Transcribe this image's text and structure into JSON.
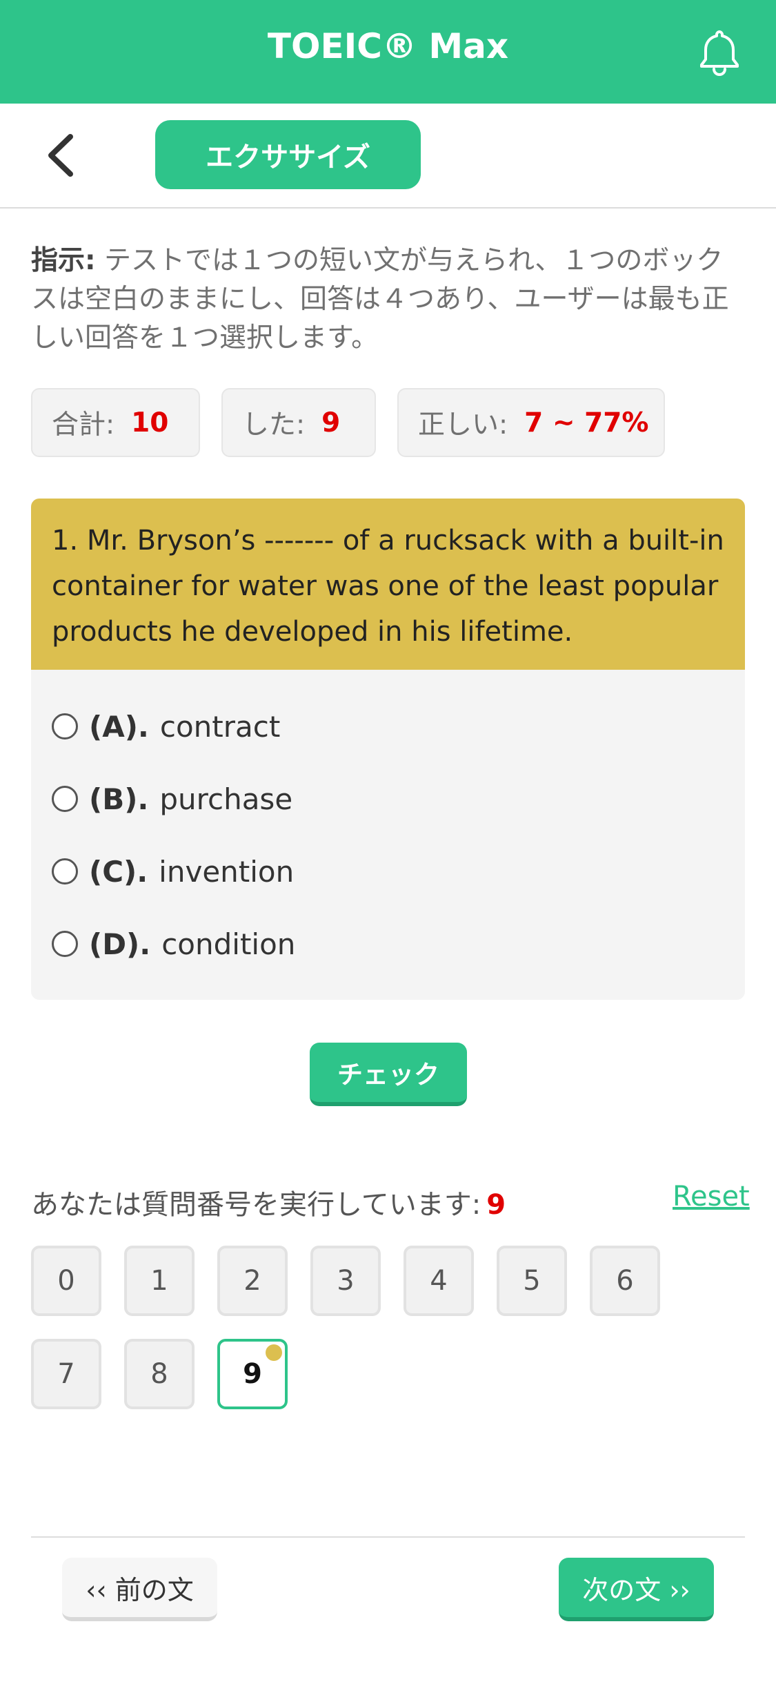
{
  "header": {
    "title": "TOEIC® Max",
    "bell_icon": "bell-icon",
    "accent_color": "#2ec48a"
  },
  "subbar": {
    "back_icon": "chevron-left-icon",
    "tab_label": "エクササイズ"
  },
  "instruction": {
    "label": "指示:",
    "text": " テストでは１つの短い文が与えられ、１つのボックスは空白のままにし、回答は４つあり、ユーザーは最も正しい回答を１つ選択します。"
  },
  "stats": {
    "total_label": "合計:",
    "total_value": "10",
    "done_label": "した:",
    "done_value": "9",
    "correct_label": "正しい:",
    "correct_value": "7 ~ 77%"
  },
  "question": {
    "text": "1. Mr. Bryson’s ------- of a rucksack with a built-in container for water was one of the least popular products he developed in his lifetime.",
    "options": [
      {
        "letter": "(A).",
        "text": "contract"
      },
      {
        "letter": "(B).",
        "text": "purchase"
      },
      {
        "letter": "(C).",
        "text": "invention"
      },
      {
        "letter": "(D).",
        "text": "condition"
      }
    ]
  },
  "check_button": "チェック",
  "progress": {
    "label": "あなたは質問番号を実行しています:",
    "current": "9",
    "reset_label": "Reset",
    "numbers": [
      "0",
      "1",
      "2",
      "3",
      "4",
      "5",
      "6",
      "7",
      "8",
      "9"
    ]
  },
  "footer": {
    "prev_label": "‹‹ 前の文",
    "next_label": "次の文 ››"
  }
}
